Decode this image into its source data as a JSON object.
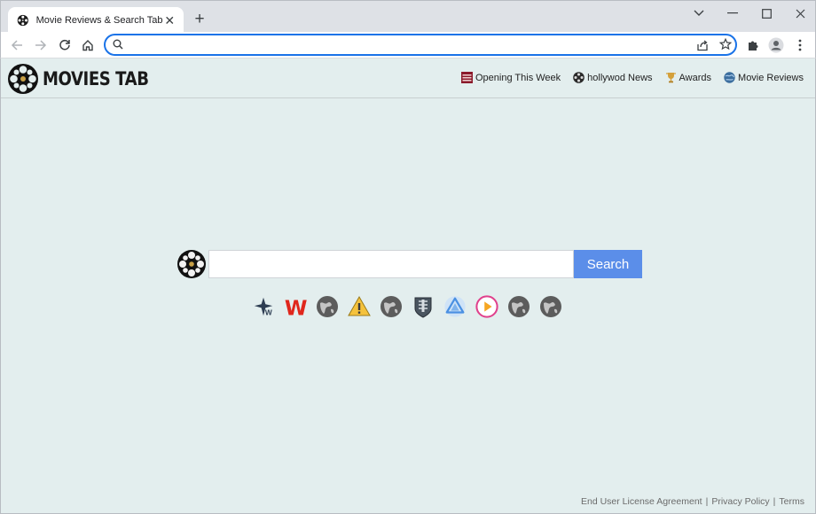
{
  "browser": {
    "tab_title": "Movie Reviews & Search Tab",
    "address_value": "",
    "address_placeholder": ""
  },
  "header": {
    "logo_text": "MOVIES TAB",
    "nav": [
      {
        "label": "Opening This Week",
        "icon": "movie-calendar-icon"
      },
      {
        "label": "hollywod News",
        "icon": "film-reel-icon"
      },
      {
        "label": "Awards",
        "icon": "trophy-icon"
      },
      {
        "label": "Movie Reviews",
        "icon": "globe-icon"
      }
    ]
  },
  "search": {
    "value": "",
    "button_label": "Search"
  },
  "shortcuts": [
    "walmart-star-icon",
    "w-letter-icon",
    "globe-icon",
    "warning-icon",
    "globe-icon",
    "world-of-tanks-icon",
    "triangle-app-icon",
    "play-icon",
    "globe-icon",
    "globe-icon"
  ],
  "footer": {
    "eula": "End User License Agreement",
    "privacy": "Privacy Policy",
    "terms": "Terms",
    "separator": "|"
  },
  "colors": {
    "search_button": "#5b8ee9",
    "omnibox_focus": "#1a73e8",
    "page_bg": "#e3eeee"
  }
}
